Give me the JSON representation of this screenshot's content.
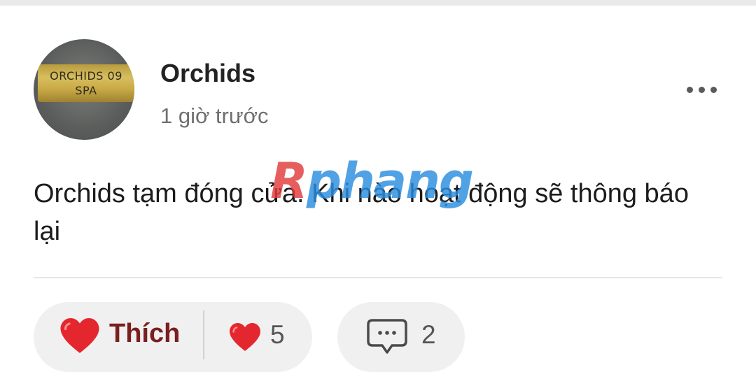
{
  "post": {
    "author": "Orchids",
    "time": "1 giờ trước",
    "avatar_text": [
      "ORCHIDS 09",
      "SPA"
    ],
    "content": "Orchids tạm đóng cửa. Khi nào hoạt động sẽ thông báo lại",
    "more_icon": "more-horizontal-icon"
  },
  "watermark": {
    "part1": "R",
    "part2": "phang"
  },
  "actions": {
    "like_label": "Thích",
    "like_icon": "heart-icon",
    "reaction_count": "5",
    "comment_icon": "comment-bubble-icon",
    "comment_count": "2"
  },
  "colors": {
    "heart": "#e4262f",
    "like_label": "#7a1f1f",
    "pill_bg": "#f0f0f1",
    "muted_text": "#6f6f6f"
  }
}
